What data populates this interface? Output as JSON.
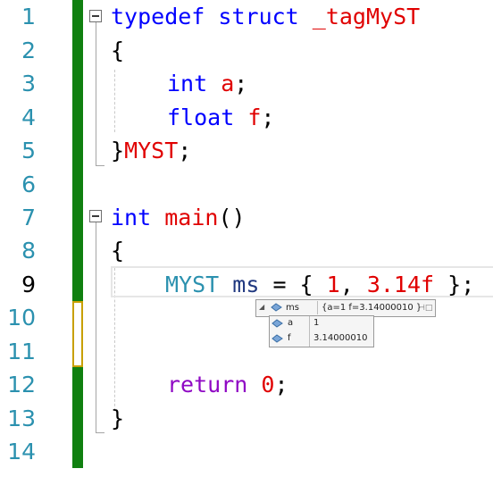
{
  "line_numbers": [
    "1",
    "2",
    "3",
    "4",
    "5",
    "6",
    "7",
    "8",
    "9",
    "10",
    "11",
    "12",
    "13",
    "14"
  ],
  "active_line": "9",
  "code": {
    "l1": {
      "kw": "typedef struct",
      "name": "_tagMyST"
    },
    "l2": "{",
    "l3": {
      "type": "int",
      "name": "a",
      "semi": ";"
    },
    "l4": {
      "type": "float",
      "name": "f",
      "semi": ";"
    },
    "l5": {
      "brace": "}",
      "name": "MYST",
      "semi": ";"
    },
    "l7": {
      "type": "int",
      "name": "main",
      "paren": "()"
    },
    "l8": "{",
    "l9": {
      "type": "MYST",
      "var": "ms",
      "eq": " = { ",
      "n1": "1",
      ",": ", ",
      "n2": "3.14f",
      "end": " };"
    },
    "l12": {
      "kw": "return",
      "n": "0",
      "semi": ";"
    },
    "l13": "}"
  },
  "datatip": {
    "expand_arrow": "◢",
    "root": {
      "name": "ms",
      "value": "{a=1 f=3.14000010 }"
    },
    "children": [
      {
        "name": "a",
        "value": "1"
      },
      {
        "name": "f",
        "value": "3.14000010"
      }
    ],
    "pin_icon": "⊣□"
  },
  "colors": {
    "change_bar": "#108010",
    "keyword": "#0000ff",
    "type": "#2b91af",
    "number": "#e00000",
    "return": "#8f08c4"
  }
}
